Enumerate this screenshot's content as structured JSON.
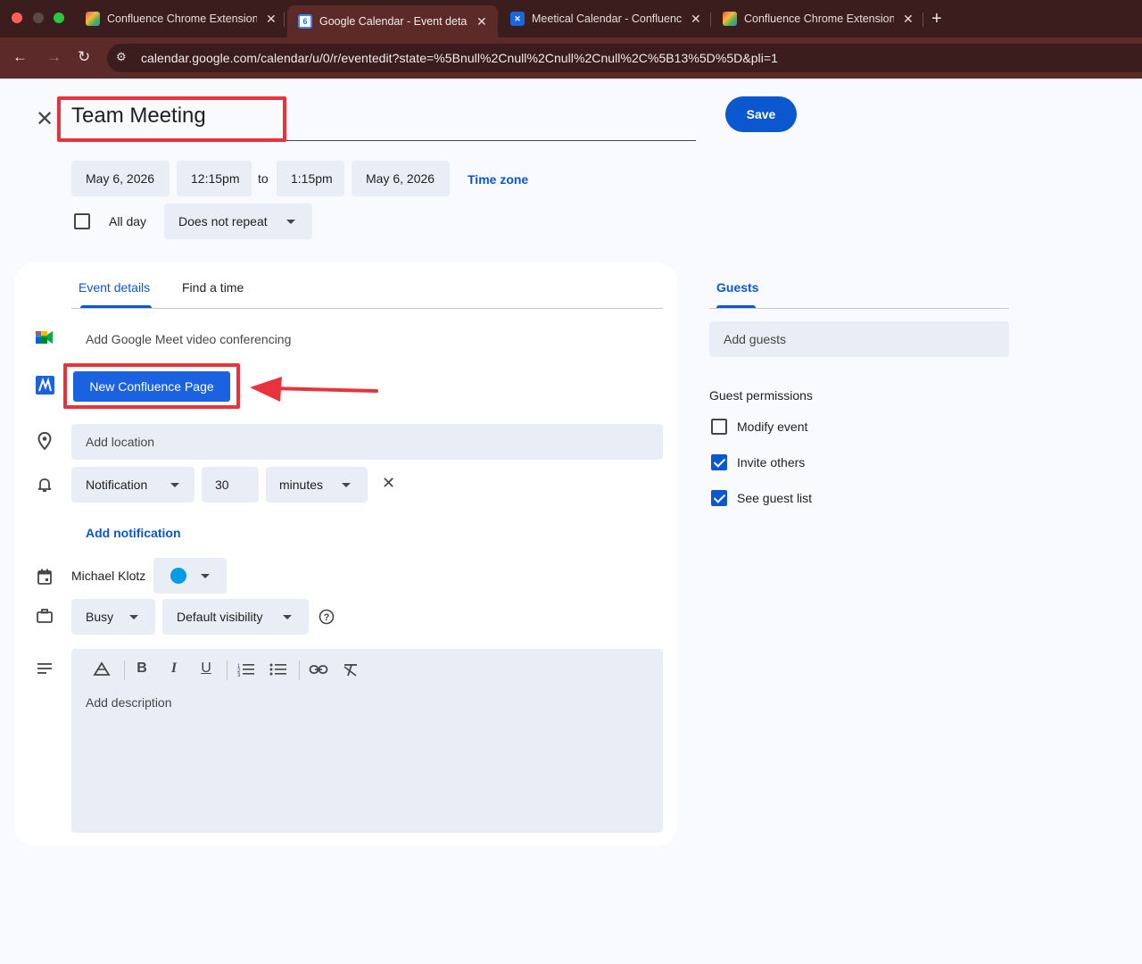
{
  "browser": {
    "tabs": [
      {
        "title": "Confluence Chrome Extension",
        "favicon": "rainbow-doc-icon"
      },
      {
        "title": "Google Calendar - Event details",
        "favicon": "google-calendar-icon"
      },
      {
        "title": "Meetical Calendar - Confluence",
        "favicon": "confluence-icon"
      },
      {
        "title": "Confluence Chrome Extension",
        "favicon": "rainbow-doc-icon"
      }
    ],
    "url": "calendar.google.com/calendar/u/0/r/eventedit?state=%5Bnull%2Cnull%2Cnull%2Cnull%2C%5B13%5D%5D&pli=1",
    "calendar_favicon_text": "6"
  },
  "event": {
    "title": "Team Meeting",
    "save_label": "Save",
    "start_date": "May 6, 2026",
    "start_time": "12:15pm",
    "to_label": "to",
    "end_time": "1:15pm",
    "end_date": "May 6, 2026",
    "time_zone_label": "Time zone",
    "all_day_label": "All day",
    "repeat_value": "Does not repeat"
  },
  "details": {
    "tab_event_details": "Event details",
    "tab_find_time": "Find a time",
    "meet_label": "Add Google Meet video conferencing",
    "confluence_button": "New Confluence Page",
    "location_placeholder": "Add location",
    "notification_type": "Notification",
    "notification_amount": "30",
    "notification_unit": "minutes",
    "add_notification": "Add notification",
    "calendar_owner": "Michael Klotz",
    "calendar_color": "#039be5",
    "availability": "Busy",
    "visibility": "Default visibility",
    "description_placeholder": "Add description"
  },
  "guests": {
    "tab_label": "Guests",
    "add_guests_placeholder": "Add guests",
    "permissions_heading": "Guest permissions",
    "permissions": [
      {
        "label": "Modify event",
        "checked": false
      },
      {
        "label": "Invite others",
        "checked": true
      },
      {
        "label": "See guest list",
        "checked": true
      }
    ]
  },
  "colors": {
    "accent": "#0b57d0",
    "highlight": "#e8323c"
  }
}
